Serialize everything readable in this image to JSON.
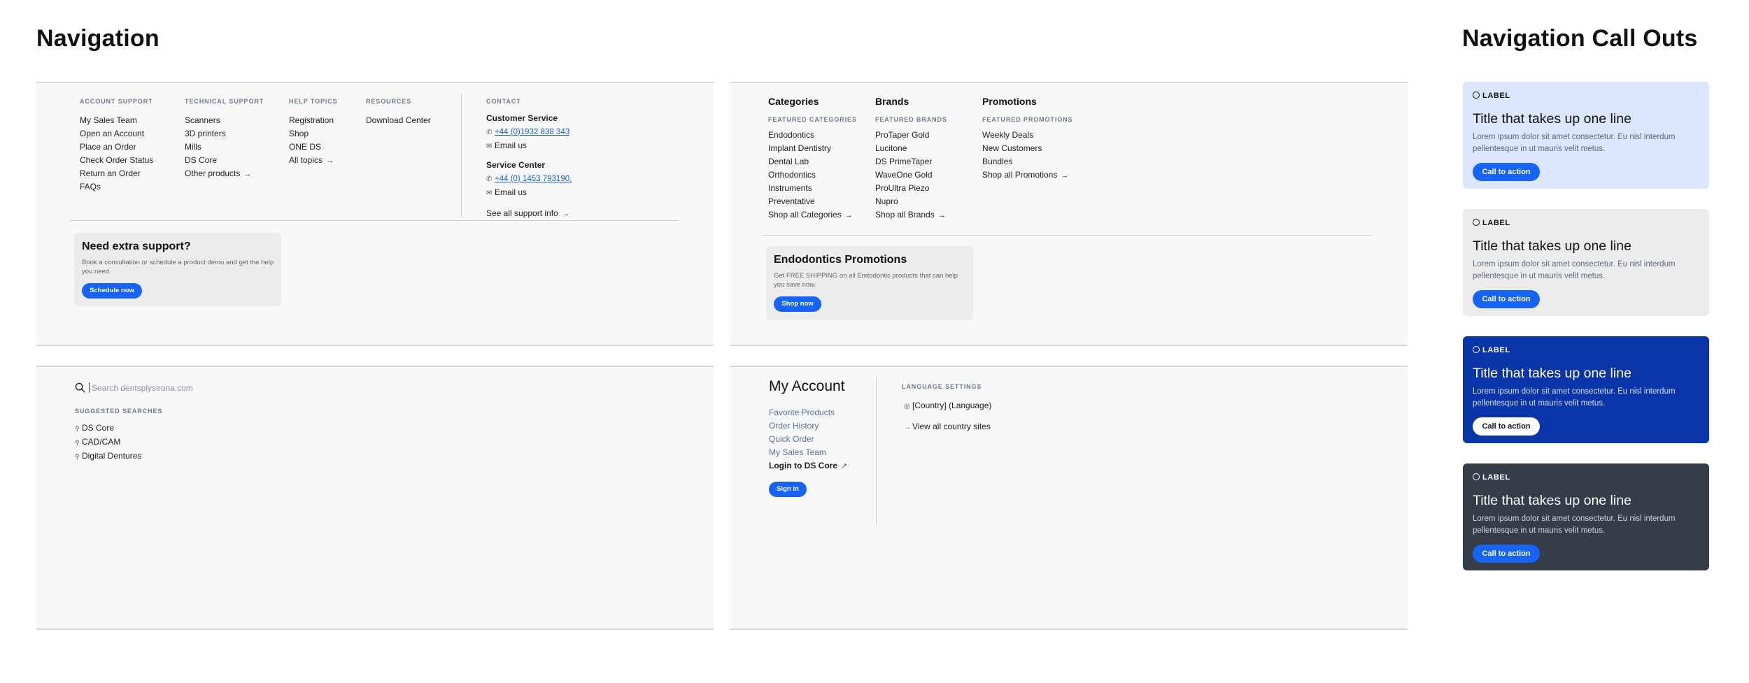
{
  "headings": {
    "navigation": "Navigation",
    "callouts": "Navigation Call Outs"
  },
  "support_menu": {
    "account_support": {
      "heading": "ACCOUNT SUPPORT",
      "items": [
        "My Sales Team",
        "Open an Account",
        "Place an Order",
        "Check Order Status",
        "Return an Order",
        "FAQs"
      ]
    },
    "technical_support": {
      "heading": "TECHNICAL SUPPORT",
      "items": [
        "Scanners",
        "3D printers",
        "Mills",
        "DS Core",
        "Other products"
      ]
    },
    "help_topics": {
      "heading": "HELP TOPICS",
      "items": [
        "Registration",
        "Shop",
        "ONE DS",
        "All topics"
      ]
    },
    "resources": {
      "heading": "RESOURCES",
      "items": [
        "Download Center"
      ]
    },
    "contact": {
      "heading": "CONTACT",
      "customer_service": {
        "title": "Customer Service",
        "phone": "+44 (0)1932 838 343",
        "email": "Email us"
      },
      "service_center": {
        "title": "Service Center",
        "phone": "+44 (0) 1453 793190,",
        "email": "Email us"
      },
      "see_all": "See all support info"
    },
    "extra_support": {
      "title": "Need extra support?",
      "description": "Book a consultation or schedule a product demo and get the help you need.",
      "button": "Schedule now"
    }
  },
  "shop_menu": {
    "categories": {
      "title": "Categories",
      "sub": "FEATURED CATEGORIES",
      "items": [
        "Endodontics",
        "Implant Dentistry",
        "Dental Lab",
        "Orthodontics",
        "Instruments",
        "Preventative"
      ],
      "link": "Shop all Categories"
    },
    "brands": {
      "title": "Brands",
      "sub": "FEATURED BRANDS",
      "items": [
        "ProTaper Gold",
        "Lucitone",
        "DS PrimeTaper",
        "WaveOne Gold",
        "ProUltra Piezo",
        "Nupro"
      ],
      "link": "Shop all Brands"
    },
    "promotions": {
      "title": "Promotions",
      "sub": "FEATURED PROMOTIONS",
      "items": [
        "Weekly Deals",
        "New Customers",
        "Bundles"
      ],
      "link": "Shop all Promotions"
    },
    "promo_card": {
      "title": "Endodontics Promotions",
      "description": "Get FREE SHIPPING on all Endodontic products that can help you save now.",
      "button": "Shop now"
    }
  },
  "search_menu": {
    "placeholder": "Search dentsplysirona.com",
    "suggested_heading": "SUGGESTED SEARCHES",
    "suggestions": [
      "DS Core",
      "CAD/CAM",
      "Digital Dentures"
    ]
  },
  "account_menu": {
    "title": "My Account",
    "items": [
      "Favorite Products",
      "Order History",
      "Quick Order",
      "My Sales Team"
    ],
    "login": "Login to DS Core",
    "sign_in": "Sign in",
    "language_heading": "LANGUAGE SETTINGS",
    "language_value": "[Country] (Language)",
    "view_all": "View all country sites"
  },
  "callouts": [
    {
      "label": "LABEL",
      "title": "Title that takes up one line",
      "body": "Lorem ipsum dolor sit amet consectetur. Eu nisl interdum pellentesque in ut mauris velit metus.",
      "cta": "Call to action",
      "bg": "#dbe5fc",
      "fg": "#111111",
      "body_color": "#5b6a84",
      "cta_bg": "#1663f5",
      "cta_fg": "#ffffff"
    },
    {
      "label": "LABEL",
      "title": "Title that takes up one line",
      "body": "Lorem ipsum dolor sit amet consectetur. Eu nisl interdum pellentesque in ut mauris velit metus.",
      "cta": "Call to action",
      "bg": "#ececec",
      "fg": "#111111",
      "body_color": "#5b6a84",
      "cta_bg": "#1663f5",
      "cta_fg": "#ffffff"
    },
    {
      "label": "LABEL",
      "title": "Title that takes up one line",
      "body": "Lorem ipsum dolor sit amet consectetur. Eu nisl interdum pellentesque in ut mauris velit metus.",
      "cta": "Call to action",
      "bg": "#0a35a8",
      "fg": "#ffffff",
      "body_color": "#d6defa",
      "cta_bg": "#ffffff",
      "cta_fg": "#111111"
    },
    {
      "label": "LABEL",
      "title": "Title that takes up one line",
      "body": "Lorem ipsum dolor sit amet consectetur. Eu nisl interdum pellentesque in ut mauris velit metus.",
      "cta": "Call to action",
      "bg": "#353d49",
      "fg": "#ffffff",
      "body_color": "#d0d4db",
      "cta_bg": "#1663f5",
      "cta_fg": "#ffffff"
    }
  ]
}
